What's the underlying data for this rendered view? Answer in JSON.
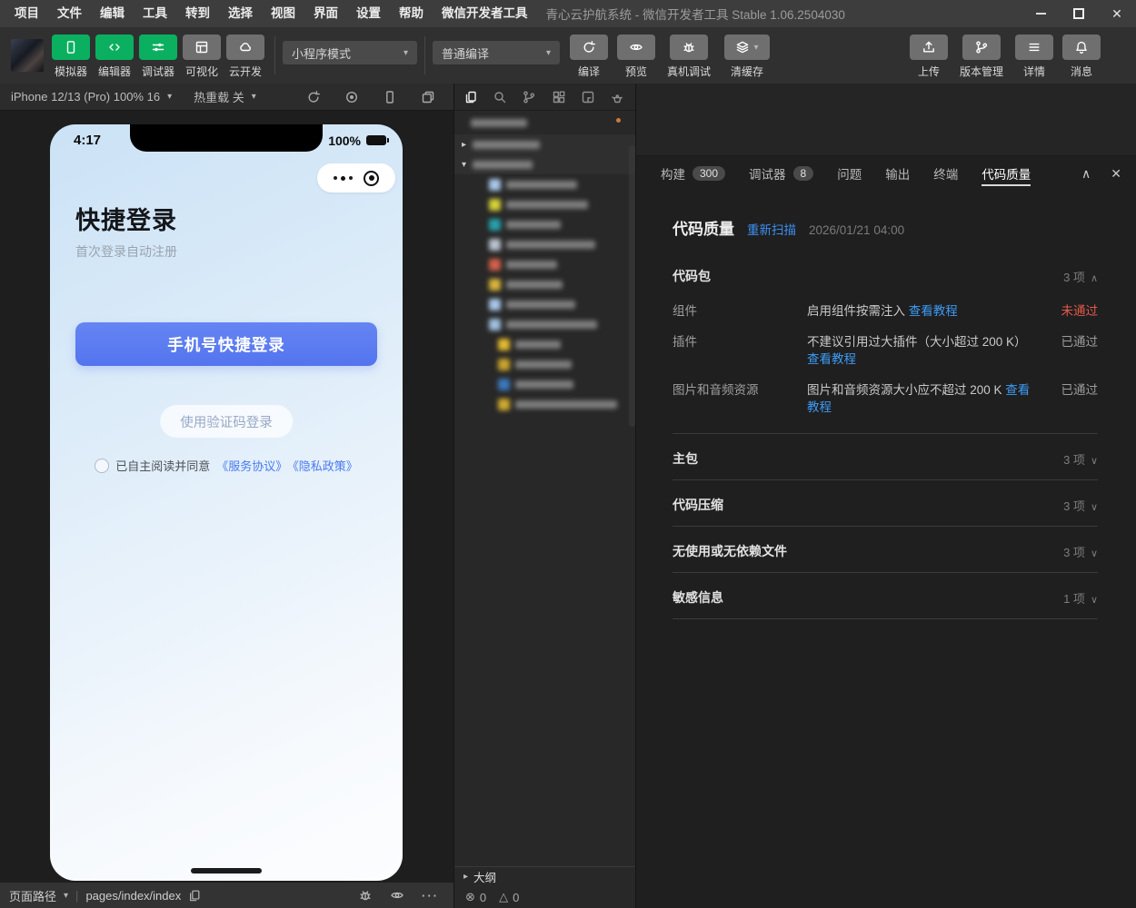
{
  "menu_bar": {
    "items": [
      "项目",
      "文件",
      "编辑",
      "工具",
      "转到",
      "选择",
      "视图",
      "界面",
      "设置",
      "帮助",
      "微信开发者工具"
    ],
    "title": "青心云护航系统 - 微信开发者工具 Stable 1.06.2504030"
  },
  "toolbar": {
    "mode_buttons": [
      {
        "name": "simulator-button",
        "icon": "phone-icon",
        "label": "模拟器",
        "active": true
      },
      {
        "name": "editor-button",
        "icon": "code-icon",
        "label": "编辑器",
        "active": true
      },
      {
        "name": "debugger-button",
        "icon": "sliders-icon",
        "label": "调试器",
        "active": true
      },
      {
        "name": "visual-button",
        "icon": "layout-icon",
        "label": "可视化",
        "active": false
      },
      {
        "name": "cloud-dev-button",
        "icon": "cloud-icon",
        "label": "云开发",
        "active": false
      }
    ],
    "mode_dropdown": "小程序模式",
    "compile_dropdown": "普通编译",
    "action_buttons": [
      {
        "name": "compile-button",
        "icon": "refresh-icon",
        "label": "编译",
        "caret": false
      },
      {
        "name": "preview-button",
        "icon": "eye-icon",
        "label": "预览",
        "caret": false
      },
      {
        "name": "remote-debug-button",
        "icon": "bug-icon",
        "label": "真机调试",
        "caret": false
      },
      {
        "name": "clear-cache-button",
        "icon": "layers-icon",
        "label": "清缓存",
        "caret": true
      }
    ],
    "right_buttons": [
      {
        "name": "upload-button",
        "icon": "upload-icon",
        "label": "上传"
      },
      {
        "name": "version-button",
        "icon": "branch-icon",
        "label": "版本管理"
      },
      {
        "name": "details-button",
        "icon": "lines-icon",
        "label": "详情"
      },
      {
        "name": "message-button",
        "icon": "bell-icon",
        "label": "消息"
      }
    ]
  },
  "simulator": {
    "device_label": "iPhone 12/13 (Pro) 100% 16",
    "hot_reload_label": "热重载 关",
    "device_icons": [
      {
        "name": "refresh-sim-button",
        "icon": "refresh-icon"
      },
      {
        "name": "record-button",
        "icon": "record-icon"
      },
      {
        "name": "device-frame-button",
        "icon": "device-icon"
      },
      {
        "name": "multi-window-button",
        "icon": "multiwindow-icon"
      }
    ],
    "status_bar": {
      "time": "4:17",
      "battery": "100%"
    },
    "page": {
      "title": "快捷登录",
      "subtitle": "首次登录自动注册",
      "primary_button": "手机号快捷登录",
      "secondary_button": "使用验证码登录",
      "agreement_text": "已自主阅读并同意",
      "agreement_links": [
        "《服务协议》",
        "《隐私政策》"
      ]
    },
    "footer": {
      "path_label": "页面路径",
      "path_value": "pages/index/index",
      "icons": [
        {
          "name": "footer-debug-button",
          "icon": "bug-icon"
        },
        {
          "name": "footer-preview-button",
          "icon": "eye-icon"
        },
        {
          "name": "footer-more-button",
          "icon": "more-icon"
        }
      ]
    }
  },
  "file_panel": {
    "iconbar": [
      {
        "name": "explorer-files-icon",
        "icon": "files-icon",
        "active": true
      },
      {
        "name": "search-icon",
        "icon": "search-icon",
        "active": false
      },
      {
        "name": "source-control-icon",
        "icon": "branch-icon",
        "active": false
      },
      {
        "name": "widgets-icon",
        "icon": "blocks-icon",
        "active": false
      },
      {
        "name": "npm-icon",
        "icon": "npm-icon",
        "active": false
      },
      {
        "name": "theme-icon",
        "icon": "teapot-icon",
        "active": false
      }
    ],
    "tree_rows": [
      {
        "kind": "project",
        "blur_w": 62,
        "dot": true
      },
      {
        "kind": "folder",
        "arrow": "collapsed",
        "blur_w": 74
      },
      {
        "kind": "folder",
        "arrow": "expanded",
        "blur_w": 66,
        "selected": true
      },
      {
        "kind": "file",
        "color": "#a9c6e8",
        "blur_w": 78
      },
      {
        "kind": "file",
        "color": "#d6d03a",
        "blur_w": 90
      },
      {
        "kind": "file",
        "color": "#28a0ab",
        "blur_w": 60
      },
      {
        "kind": "file",
        "color": "#b9c2cf",
        "blur_w": 98
      },
      {
        "kind": "file",
        "color": "#d2604a",
        "blur_w": 56
      },
      {
        "kind": "file",
        "color": "#d8b33c",
        "blur_w": 62
      },
      {
        "kind": "file",
        "color": "#a9c6e8",
        "blur_w": 76
      },
      {
        "kind": "file",
        "color": "#9fc0de",
        "blur_w": 100
      },
      {
        "kind": "file",
        "color": "#e2b92f",
        "blur_w": 50,
        "deep": true
      },
      {
        "kind": "file",
        "color": "#c8a42e",
        "blur_w": 62,
        "deep": true
      },
      {
        "kind": "file",
        "color": "#3c78bb",
        "blur_w": 64,
        "deep": true
      },
      {
        "kind": "file",
        "color": "#cfa92f",
        "blur_w": 112,
        "deep": true
      }
    ],
    "outline_label": "大纲",
    "problems": {
      "errors": "0",
      "warnings": "0"
    }
  },
  "console": {
    "tabs": [
      {
        "name": "tab-build",
        "label": "构建",
        "badge": "300",
        "active": false
      },
      {
        "name": "tab-debugger",
        "label": "调试器",
        "badge": "8",
        "active": false
      },
      {
        "name": "tab-problems",
        "label": "问题",
        "active": false
      },
      {
        "name": "tab-output",
        "label": "输出",
        "active": false
      },
      {
        "name": "tab-terminal",
        "label": "终端",
        "active": false
      },
      {
        "name": "tab-code-quality",
        "label": "代码质量",
        "active": true
      }
    ],
    "quality": {
      "title": "代码质量",
      "rescan_label": "重新扫描",
      "scan_time": "2026/01/21 04:00",
      "groups": [
        {
          "name": "code-package",
          "label": "代码包",
          "count": "3 项",
          "expanded": true,
          "rows": [
            {
              "name": "component",
              "label": "组件",
              "desc": "启用组件按需注入",
              "link": "查看教程",
              "status": "未通过",
              "status_type": "fail"
            },
            {
              "name": "plugin",
              "label": "插件",
              "desc": "不建议引用过大插件（大小超过 200 K）",
              "link": "查看教程",
              "status": "已通过",
              "status_type": "pass"
            },
            {
              "name": "image-audio",
              "label": "图片和音频资源",
              "desc": "图片和音频资源大小应不超过 200 K",
              "link": "查看教程",
              "status": "已通过",
              "status_type": "pass"
            }
          ]
        },
        {
          "name": "main-package",
          "label": "主包",
          "count": "3 项",
          "expanded": false,
          "rows": []
        },
        {
          "name": "code-compression",
          "label": "代码压缩",
          "count": "3 项",
          "expanded": false,
          "rows": []
        },
        {
          "name": "unused-files",
          "label": "无使用或无依赖文件",
          "count": "3 项",
          "expanded": false,
          "rows": []
        },
        {
          "name": "sensitive-info",
          "label": "敏感信息",
          "count": "1 项",
          "expanded": false,
          "rows": []
        }
      ]
    }
  }
}
